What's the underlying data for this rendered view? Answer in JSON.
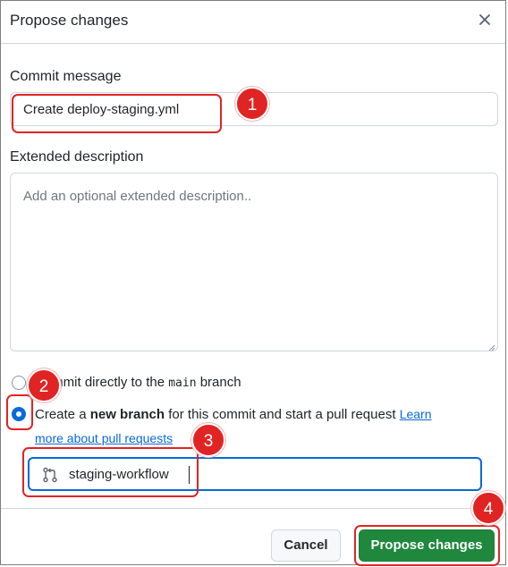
{
  "dialog": {
    "title": "Propose changes",
    "close_icon": "x-icon"
  },
  "commit_message": {
    "label": "Commit message",
    "value": "Create deploy-staging.yml"
  },
  "extended_description": {
    "label": "Extended description",
    "placeholder": "Add an optional extended description.."
  },
  "commit_options": {
    "direct": {
      "prefix": "Commit directly to the ",
      "branch_code": "main",
      "suffix": " branch",
      "selected": false
    },
    "new_branch": {
      "prefix": "Create a ",
      "bold": "new branch",
      "suffix": " for this commit and start a pull request ",
      "link_line1": "Learn",
      "link_line2": "more about pull requests",
      "selected": true
    }
  },
  "branch_name": {
    "icon": "git-pull-request-icon",
    "value": "staging-workflow"
  },
  "footer": {
    "cancel_label": "Cancel",
    "propose_label": "Propose changes"
  },
  "annotations": [
    "1",
    "2",
    "3",
    "4"
  ],
  "colors": {
    "annotation_red": "#e02424",
    "primary_green": "#1f883d",
    "link_blue": "#0969da",
    "radio_blue": "#0969da"
  }
}
